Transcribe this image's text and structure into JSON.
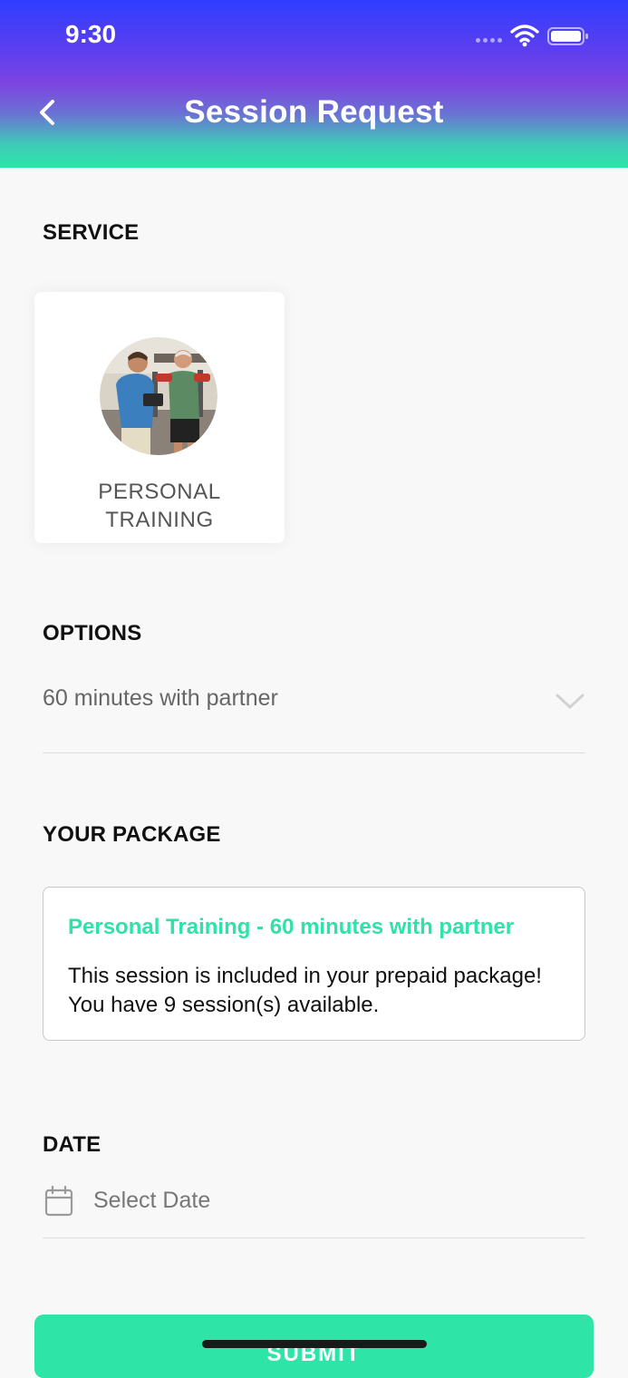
{
  "status_bar": {
    "time": "9:30"
  },
  "header": {
    "title": "Session Request"
  },
  "service": {
    "section_label": "SERVICE",
    "card_name": "PERSONAL\nTRAINING"
  },
  "options": {
    "section_label": "OPTIONS",
    "selected_value": "60 minutes with partner"
  },
  "package": {
    "section_label": "YOUR PACKAGE",
    "title": "Personal Training - 60 minutes with partner",
    "description": "This session is included in your prepaid package! You have 9 session(s) available."
  },
  "date": {
    "section_label": "DATE",
    "placeholder": "Select Date"
  },
  "submit": {
    "label": "SUBMIT"
  },
  "colors": {
    "accent": "#2ee5a7",
    "header_top": "#2f3dff",
    "header_mid": "#7d44e0",
    "header_bottom": "#2ce6a6"
  }
}
